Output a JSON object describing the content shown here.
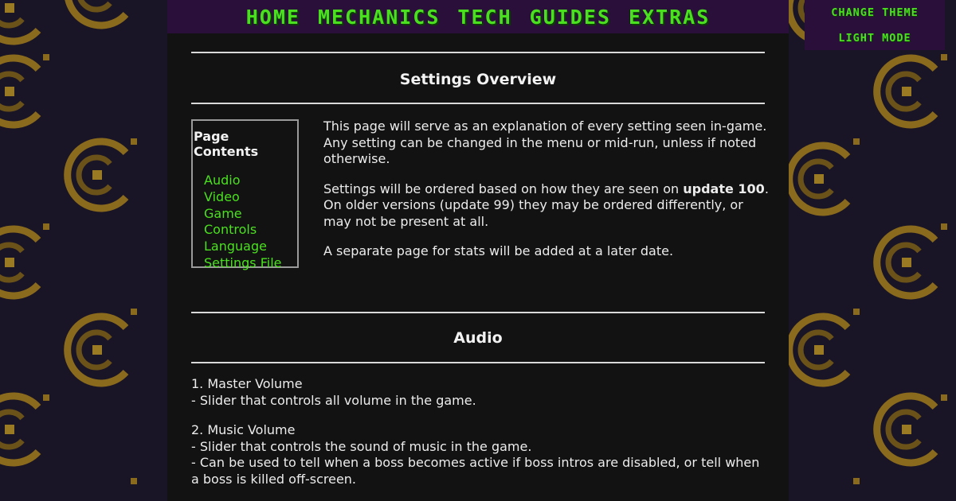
{
  "nav": {
    "items": [
      "HOME",
      "MECHANICS",
      "TECH",
      "GUIDES",
      "EXTRAS"
    ]
  },
  "theme": {
    "change_label": "CHANGE THEME",
    "light_label": "LIGHT MODE"
  },
  "page": {
    "title": "Settings Overview",
    "toc": {
      "title": "Page Contents",
      "items": [
        "Audio",
        "Video",
        "Game",
        "Controls",
        "Language",
        "Settings File"
      ]
    },
    "intro": {
      "p1": "This page will serve as an explanation of every setting seen in-game. Any setting can be changed in the menu or mid-run, unless if noted otherwise.",
      "p2_before": "Settings will be ordered based on how they are seen on ",
      "p2_bold": "update 100",
      "p2_after": ". On older versions (update 99) they may be ordered differently, or may not be present at all.",
      "p3": "A separate page for stats will be added at a later date."
    },
    "audio": {
      "title": "Audio",
      "items": [
        {
          "name": "1. Master Volume",
          "lines": [
            "- Slider that controls all volume in the game."
          ]
        },
        {
          "name": "2. Music Volume",
          "lines": [
            "- Slider that controls the sound of music in the game.",
            "- Can be used to tell when a boss becomes active if boss intros are disabled, or tell when a boss is killed off-screen."
          ]
        }
      ]
    }
  },
  "colors": {
    "background": "#1a1526",
    "accent_green": "#4be01f",
    "nav_bar": "#2a0f3a",
    "content_bg": "#121212",
    "pattern_gold": "#8a6a1c"
  }
}
